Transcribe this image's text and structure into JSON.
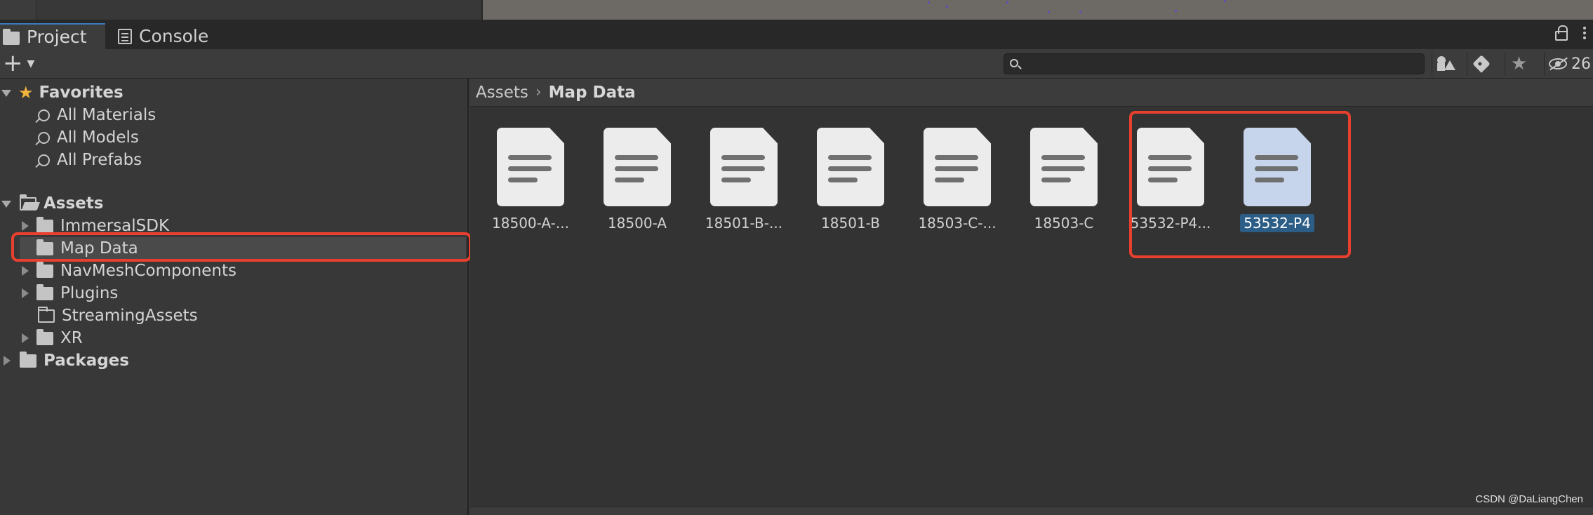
{
  "tabs": [
    {
      "label": "Project",
      "icon": "folder-icon",
      "active": true
    },
    {
      "label": "Console",
      "icon": "console-icon",
      "active": false
    }
  ],
  "toolbar": {
    "add_label": "+",
    "search_value": "",
    "hidden_count": "26"
  },
  "tree": {
    "favorites": {
      "label": "Favorites",
      "items": [
        "All Materials",
        "All Models",
        "All Prefabs"
      ]
    },
    "assets": {
      "label": "Assets",
      "items": [
        "ImmersalSDK",
        "Map Data",
        "NavMeshComponents",
        "Plugins",
        "StreamingAssets",
        "XR"
      ]
    },
    "packages": {
      "label": "Packages"
    }
  },
  "breadcrumb": {
    "root": "Assets",
    "current": "Map Data"
  },
  "assets": [
    {
      "label": "18500-A-...",
      "selected": false
    },
    {
      "label": "18500-A",
      "selected": false
    },
    {
      "label": "18501-B-...",
      "selected": false
    },
    {
      "label": "18501-B",
      "selected": false
    },
    {
      "label": "18503-C-...",
      "selected": false
    },
    {
      "label": "18503-C",
      "selected": false
    },
    {
      "label": "53532-P4...",
      "selected": false
    },
    {
      "label": "53532-P4",
      "selected": true
    }
  ],
  "watermark": "CSDN @DaLiangChen",
  "colors": {
    "highlight": "#e8402e",
    "selection": "#2c5d87",
    "tab_accent": "#3a79bb"
  }
}
